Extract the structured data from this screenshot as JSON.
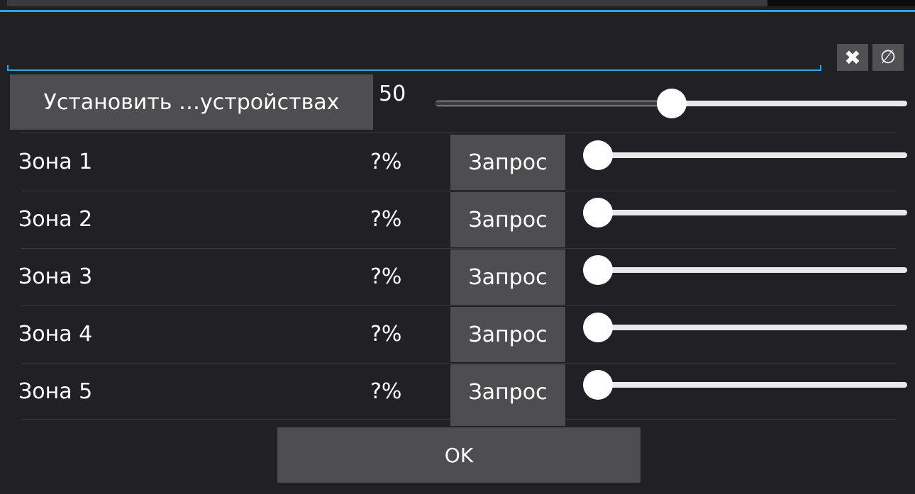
{
  "colors": {
    "accent": "#2aa7e0",
    "background": "#212024",
    "button": "#4e4e50"
  },
  "search": {
    "value": "",
    "placeholder": ""
  },
  "toolbar": {
    "clear_icon": "✖",
    "empty_icon": "∅"
  },
  "set_all": {
    "label": "Установить …устройствах",
    "value": "50",
    "slider_fraction": 0.5
  },
  "zones": [
    {
      "name": "Зона 1",
      "percent": "?%",
      "button": "Запрос",
      "slider_fraction": 0
    },
    {
      "name": "Зона 2",
      "percent": "?%",
      "button": "Запрос",
      "slider_fraction": 0
    },
    {
      "name": "Зона 3",
      "percent": "?%",
      "button": "Запрос",
      "slider_fraction": 0
    },
    {
      "name": "Зона 4",
      "percent": "?%",
      "button": "Запрос",
      "slider_fraction": 0
    },
    {
      "name": "Зона 5",
      "percent": "?%",
      "button": "Запрос",
      "slider_fraction": 0
    }
  ],
  "ok_label": "OK"
}
